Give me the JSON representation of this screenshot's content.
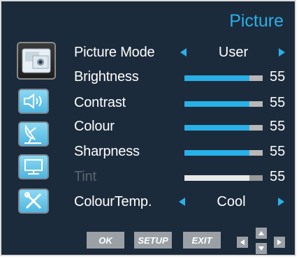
{
  "menu": {
    "title": "Picture",
    "accent_color": "#2ab0e8",
    "background_color": "#1c2b3b"
  },
  "sidebar": {
    "items": [
      {
        "name": "picture",
        "icon": "picture-icon",
        "active": true
      },
      {
        "name": "sound",
        "icon": "speaker-icon",
        "active": false
      },
      {
        "name": "channel",
        "icon": "satellite-dish-icon",
        "active": false
      },
      {
        "name": "screen",
        "icon": "monitor-icon",
        "active": false
      },
      {
        "name": "setup",
        "icon": "tools-icon",
        "active": false
      }
    ]
  },
  "settings": {
    "picture_mode": {
      "label": "Picture Mode",
      "value": "User"
    },
    "brightness": {
      "label": "Brightness",
      "value": "55",
      "level": 0.55
    },
    "contrast": {
      "label": "Contrast",
      "value": "55",
      "level": 0.55
    },
    "colour": {
      "label": "Colour",
      "value": "55",
      "level": 0.55
    },
    "sharpness": {
      "label": "Sharpness",
      "value": "55",
      "level": 0.55
    },
    "tint": {
      "label": "Tint",
      "value": "55",
      "level": 0.55,
      "disabled": true
    },
    "colour_temp": {
      "label": "ColourTemp.",
      "value": "Cool"
    }
  },
  "footer": {
    "ok_label": "OK",
    "setup_label": "SETUP",
    "exit_label": "EXIT",
    "nav_icons": [
      "arrow-left-icon",
      "arrow-up-icon",
      "arrow-down-icon",
      "arrow-right-icon"
    ]
  }
}
